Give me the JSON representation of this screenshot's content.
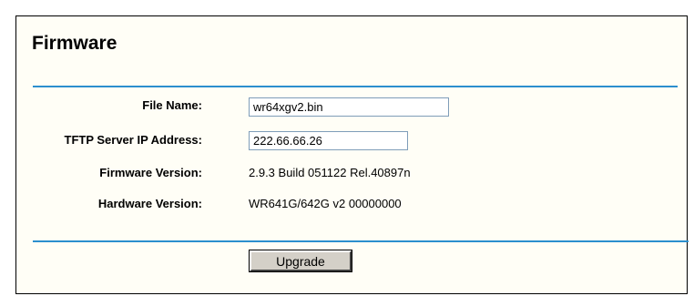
{
  "page": {
    "title": "Firmware"
  },
  "form": {
    "file_name": {
      "label": "File Name:",
      "value": "wr64xgv2.bin"
    },
    "tftp_server_ip": {
      "label": "TFTP Server IP Address:",
      "value": "222.66.66.26"
    },
    "firmware_version": {
      "label": "Firmware Version:",
      "value": "2.9.3 Build 051122 Rel.40897n"
    },
    "hardware_version": {
      "label": "Hardware Version:",
      "value": "WR641G/642G v2 00000000"
    }
  },
  "actions": {
    "upgrade_label": "Upgrade"
  },
  "colors": {
    "divider": "#2c8fce",
    "panel_background": "#fffef6",
    "button_face": "#d4d0c8"
  }
}
